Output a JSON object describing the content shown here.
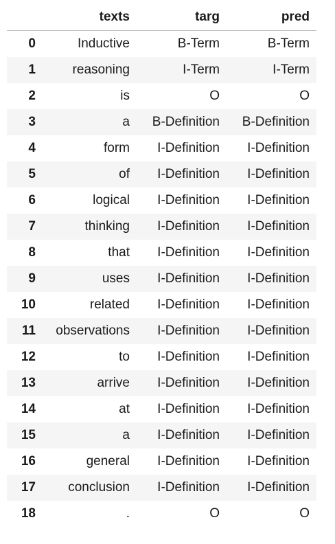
{
  "table": {
    "columns": [
      "",
      "texts",
      "targ",
      "pred"
    ],
    "rows": [
      {
        "index": "0",
        "texts": "Inductive",
        "targ": "B-Term",
        "pred": "B-Term"
      },
      {
        "index": "1",
        "texts": "reasoning",
        "targ": "I-Term",
        "pred": "I-Term"
      },
      {
        "index": "2",
        "texts": "is",
        "targ": "O",
        "pred": "O"
      },
      {
        "index": "3",
        "texts": "a",
        "targ": "B-Definition",
        "pred": "B-Definition"
      },
      {
        "index": "4",
        "texts": "form",
        "targ": "I-Definition",
        "pred": "I-Definition"
      },
      {
        "index": "5",
        "texts": "of",
        "targ": "I-Definition",
        "pred": "I-Definition"
      },
      {
        "index": "6",
        "texts": "logical",
        "targ": "I-Definition",
        "pred": "I-Definition"
      },
      {
        "index": "7",
        "texts": "thinking",
        "targ": "I-Definition",
        "pred": "I-Definition"
      },
      {
        "index": "8",
        "texts": "that",
        "targ": "I-Definition",
        "pred": "I-Definition"
      },
      {
        "index": "9",
        "texts": "uses",
        "targ": "I-Definition",
        "pred": "I-Definition"
      },
      {
        "index": "10",
        "texts": "related",
        "targ": "I-Definition",
        "pred": "I-Definition"
      },
      {
        "index": "11",
        "texts": "observations",
        "targ": "I-Definition",
        "pred": "I-Definition"
      },
      {
        "index": "12",
        "texts": "to",
        "targ": "I-Definition",
        "pred": "I-Definition"
      },
      {
        "index": "13",
        "texts": "arrive",
        "targ": "I-Definition",
        "pred": "I-Definition"
      },
      {
        "index": "14",
        "texts": "at",
        "targ": "I-Definition",
        "pred": "I-Definition"
      },
      {
        "index": "15",
        "texts": "a",
        "targ": "I-Definition",
        "pred": "I-Definition"
      },
      {
        "index": "16",
        "texts": "general",
        "targ": "I-Definition",
        "pred": "I-Definition"
      },
      {
        "index": "17",
        "texts": "conclusion",
        "targ": "I-Definition",
        "pred": "I-Definition"
      },
      {
        "index": "18",
        "texts": ".",
        "targ": "O",
        "pred": "O"
      }
    ]
  }
}
